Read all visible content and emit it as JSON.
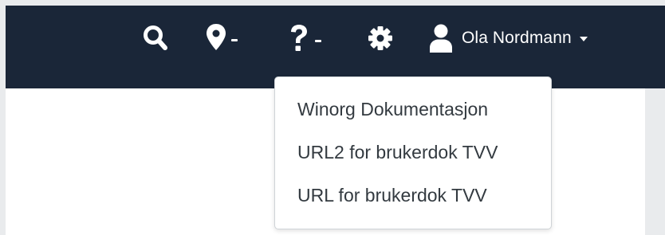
{
  "header": {
    "user_name": "Ola Nordmann",
    "icons": [
      "search-icon",
      "map-marker-icon",
      "question-icon",
      "gear-icon",
      "user-icon"
    ]
  },
  "help_menu": {
    "items": [
      {
        "label": "Winorg Dokumentasjon"
      },
      {
        "label": "URL2 for brukerdok TVV"
      },
      {
        "label": "URL for brukerdok TVV"
      }
    ]
  },
  "colors": {
    "header_bg": "#1a2638",
    "page_bg": "#e9ebed",
    "content_bg": "#ffffff",
    "menu_text": "#333a40"
  }
}
